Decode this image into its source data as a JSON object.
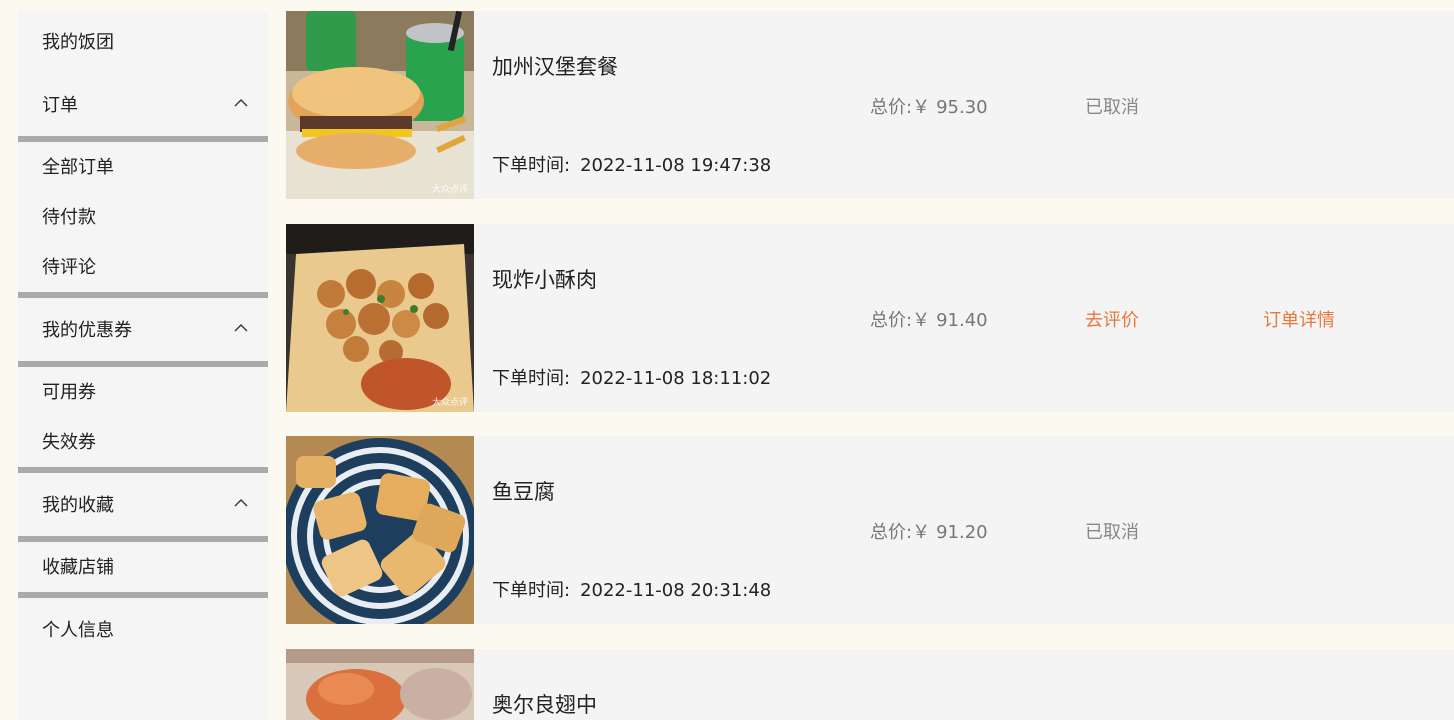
{
  "sidebar": {
    "my_group": "我的饭团",
    "orders_section": "订单",
    "all_orders": "全部订单",
    "pending_payment": "待付款",
    "pending_review": "待评论",
    "coupons_section": "我的优惠券",
    "available_coupons": "可用券",
    "expired_coupons": "失效券",
    "favorites_section": "我的收藏",
    "favorite_shops": "收藏店铺",
    "personal_info": "个人信息",
    "chevron_icon": "chevron-up-icon"
  },
  "orders": [
    {
      "title": "加州汉堡套餐",
      "price_label": "总价:￥",
      "price": "95.30",
      "status": "已取消",
      "detail": "",
      "time_label": "下单时间:",
      "time": "2022-11-08 19:47:38",
      "watermark": "大众点评"
    },
    {
      "title": "现炸小酥肉",
      "price_label": "总价:￥",
      "price": "91.40",
      "status": "去评价",
      "detail": "订单详情",
      "time_label": "下单时间:",
      "time": "2022-11-08 18:11:02",
      "watermark": "大众点评"
    },
    {
      "title": "鱼豆腐",
      "price_label": "总价:￥",
      "price": "91.20",
      "status": "已取消",
      "detail": "",
      "time_label": "下单时间:",
      "time": "2022-11-08 20:31:48",
      "watermark": ""
    },
    {
      "title": "奥尔良翅中"
    }
  ],
  "colors": {
    "page_bg": "#fcfaf0",
    "panel_bg": "#f4f4f4",
    "accent": "#e8783c",
    "divider": "#aaaaaa",
    "muted_text": "#888888"
  }
}
